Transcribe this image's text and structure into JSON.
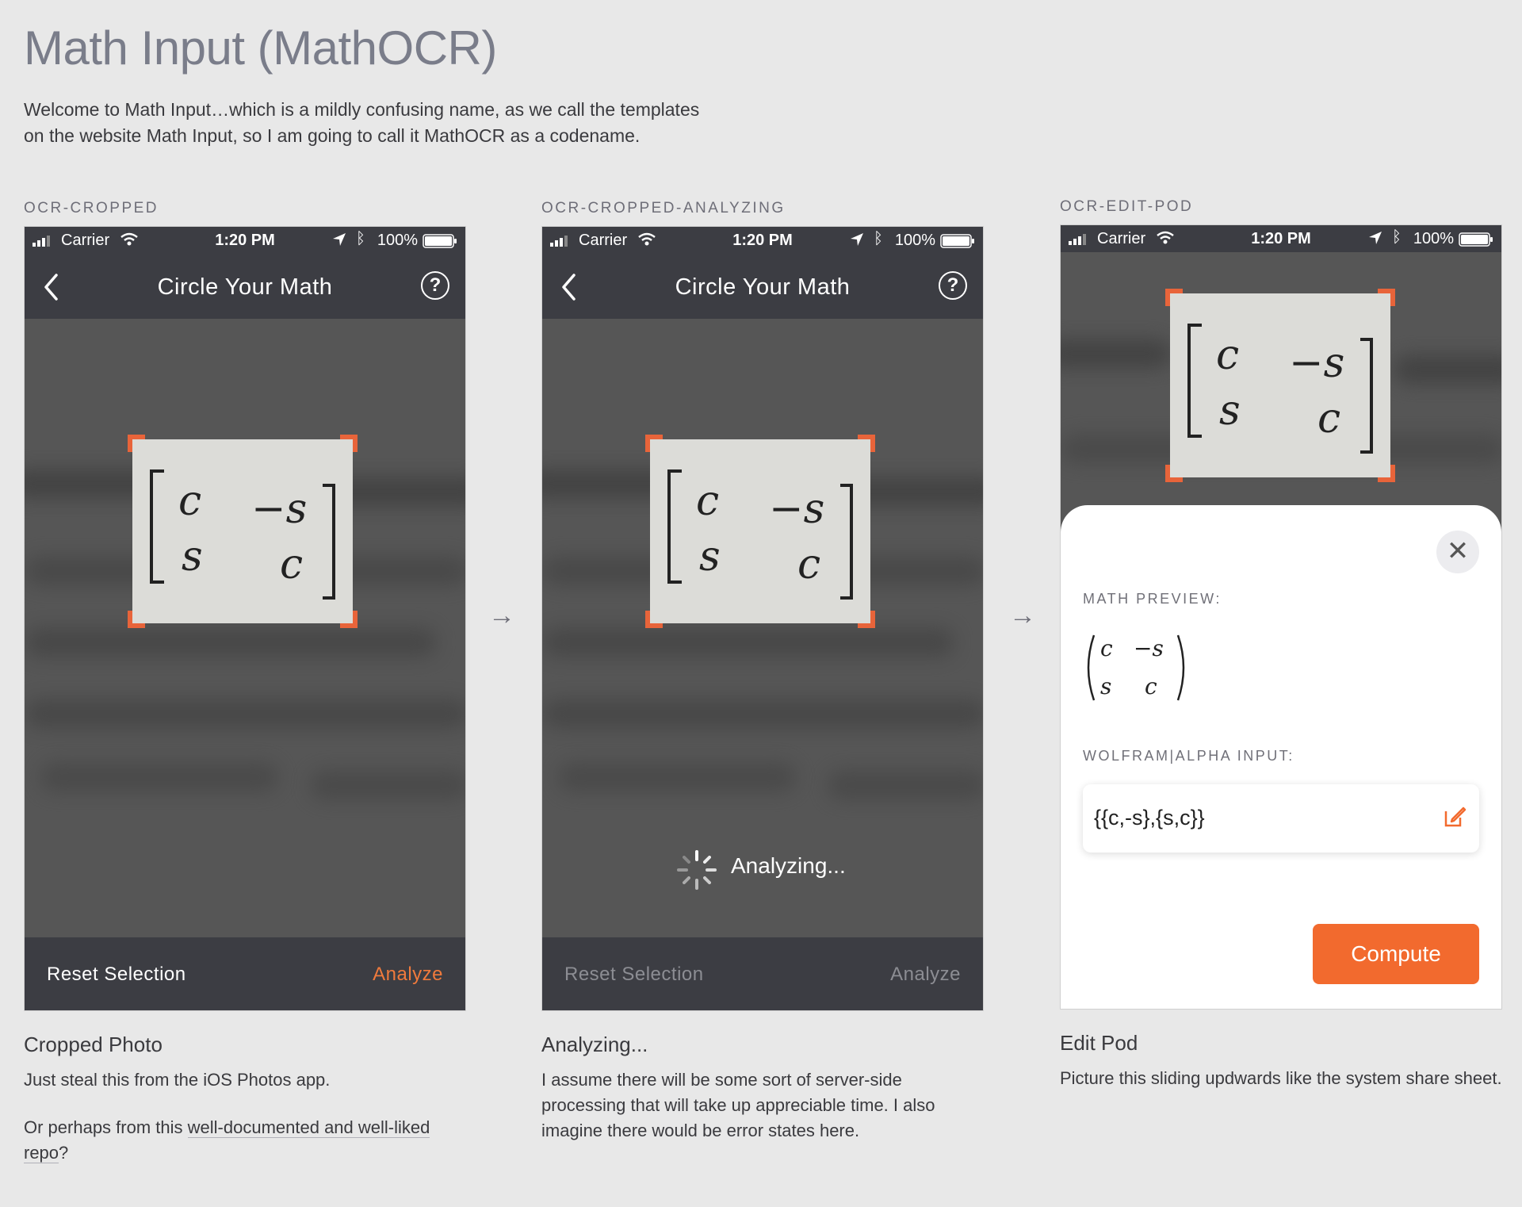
{
  "page": {
    "title": "Math Input (MathOCR)",
    "intro": "Welcome to Math Input…which is a mildly confusing name, as we call the templates on the website Math Input, so I am going to call it MathOCR as a codename."
  },
  "status_bar": {
    "carrier": "Carrier",
    "time": "1:20 PM",
    "battery": "100%"
  },
  "nav": {
    "title": "Circle Your Math",
    "help": "?"
  },
  "matrix": {
    "cells": [
      "c",
      "−s",
      "s",
      "c"
    ]
  },
  "screens": [
    {
      "label": "OCR-CROPPED",
      "toolbar": {
        "reset": "Reset Selection",
        "analyze": "Analyze"
      },
      "caption_title": "Cropped Photo",
      "caption_text": "Just steal this from the iOS Photos app.",
      "caption_text2_prefix": "Or perhaps from this ",
      "caption_link": "well-documented and well-liked repo",
      "caption_text2_suffix": "?"
    },
    {
      "label": "OCR-CROPPED-ANALYZING",
      "toolbar": {
        "reset": "Reset Selection",
        "analyze": "Analyze"
      },
      "status": "Analyzing...",
      "caption_title": "Analyzing...",
      "caption_text": "I assume there will be some sort of server-side processing that will take up appreciable time. I also imagine there would be error states here."
    },
    {
      "label": "OCR-EDIT-POD",
      "sheet": {
        "close": "✕",
        "preview_label": "MATH PREVIEW:",
        "input_label": "WOLFRAM|ALPHA INPUT:",
        "input_value": "{{c,-s},{s,c}}",
        "compute": "Compute"
      },
      "caption_title": "Edit Pod",
      "caption_text": "Picture this sliding updwards like the system share sheet."
    }
  ],
  "arrows": [
    "→",
    "→"
  ],
  "colors": {
    "accent": "#f26a2e",
    "crop_corner": "#e8643a",
    "bar": "#3c3d43",
    "background": "#e8e8e8"
  },
  "icons": {
    "back": "chevron-left-icon",
    "help": "question-circle-icon",
    "close": "close-icon",
    "edit": "edit-icon",
    "spinner": "spinner-icon"
  }
}
